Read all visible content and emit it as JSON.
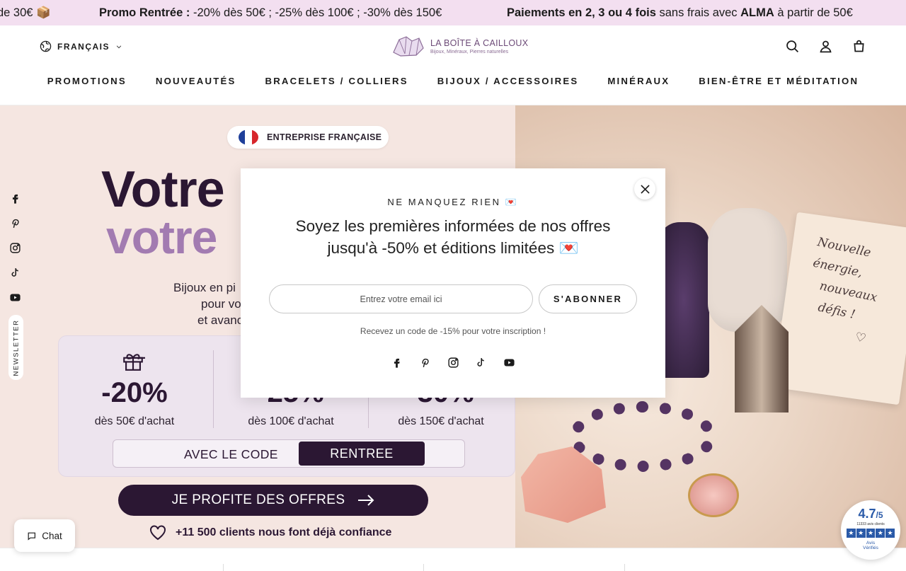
{
  "announcement": {
    "left_fragment": "de 30€ 📦",
    "promo_label": "Promo Rentrée :",
    "promo_text": " -20% dès 50€ ; -25% dès 100€ ; -30% dès 150€",
    "pay_label": "Paiements en 2, 3 ou 4 fois",
    "pay_text_mid": " sans frais avec ",
    "pay_brand": "ALMA",
    "pay_text_end": " à partir de 50€"
  },
  "header": {
    "language": "FRANÇAIS",
    "logo_title": "LA BOÎTE À CAILLOUX",
    "logo_tagline": "Bijoux, Minéraux, Pierres naturelles",
    "nav": [
      "PROMOTIONS",
      "NOUVEAUTÉS",
      "BRACELETS / COLLIERS",
      "BIJOUX / ACCESSOIRES",
      "MINÉRAUX",
      "BIEN-ÊTRE ET MÉDITATION"
    ],
    "icons": [
      "search-icon",
      "account-icon",
      "cart-icon"
    ]
  },
  "hero": {
    "badge": "ENTREPRISE FRANÇAISE",
    "title_line1": "Votre",
    "title_line2": "votre",
    "subtitle_lines": [
      "Bijoux en pi",
      "pour vo",
      "et avanc"
    ],
    "offers": [
      {
        "percent": "-20%",
        "condition": "dès 50€ d'achat"
      },
      {
        "percent": "-25%",
        "condition": "dès 100€ d'achat"
      },
      {
        "percent": "-30%",
        "condition": "dès 150€ d'achat"
      }
    ],
    "code_label": "AVEC LE CODE",
    "code_value": "RENTREE",
    "cta": "JE PROFITE DES OFFRES",
    "trust": "+11 500 clients nous font déjà confiance",
    "card_text": [
      "Nouvelle énergie,",
      "nouveaux",
      "défis !"
    ]
  },
  "side_social": [
    "facebook-icon",
    "pinterest-icon",
    "instagram-icon",
    "tiktok-icon",
    "youtube-icon"
  ],
  "newsletter_tab": "NEWSLETTER",
  "chat": {
    "label": "Chat"
  },
  "rating": {
    "score": "4.7",
    "out_of": "/5",
    "count": "11333 avis clients",
    "brand_line1": "Avis",
    "brand_line2": "Vérifiés"
  },
  "modal": {
    "eyebrow": "NE MANQUEZ RIEN 💌",
    "headline_line1": "Soyez les premières informées de nos offres",
    "headline_line2": "jusqu'à -50% et éditions limitées 💌",
    "email_placeholder": "Entrez votre email ici",
    "subscribe": "S'ABONNER",
    "note": "Recevez un code de -15% pour votre inscription !",
    "social": [
      "facebook-icon",
      "pinterest-icon",
      "instagram-icon",
      "tiktok-icon",
      "youtube-icon"
    ]
  },
  "colors": {
    "announce_bg": "#f3dff0",
    "brand_dark": "#2b1733",
    "brand_lilac": "#a27bb1",
    "rating_blue": "#2a5aa8"
  }
}
